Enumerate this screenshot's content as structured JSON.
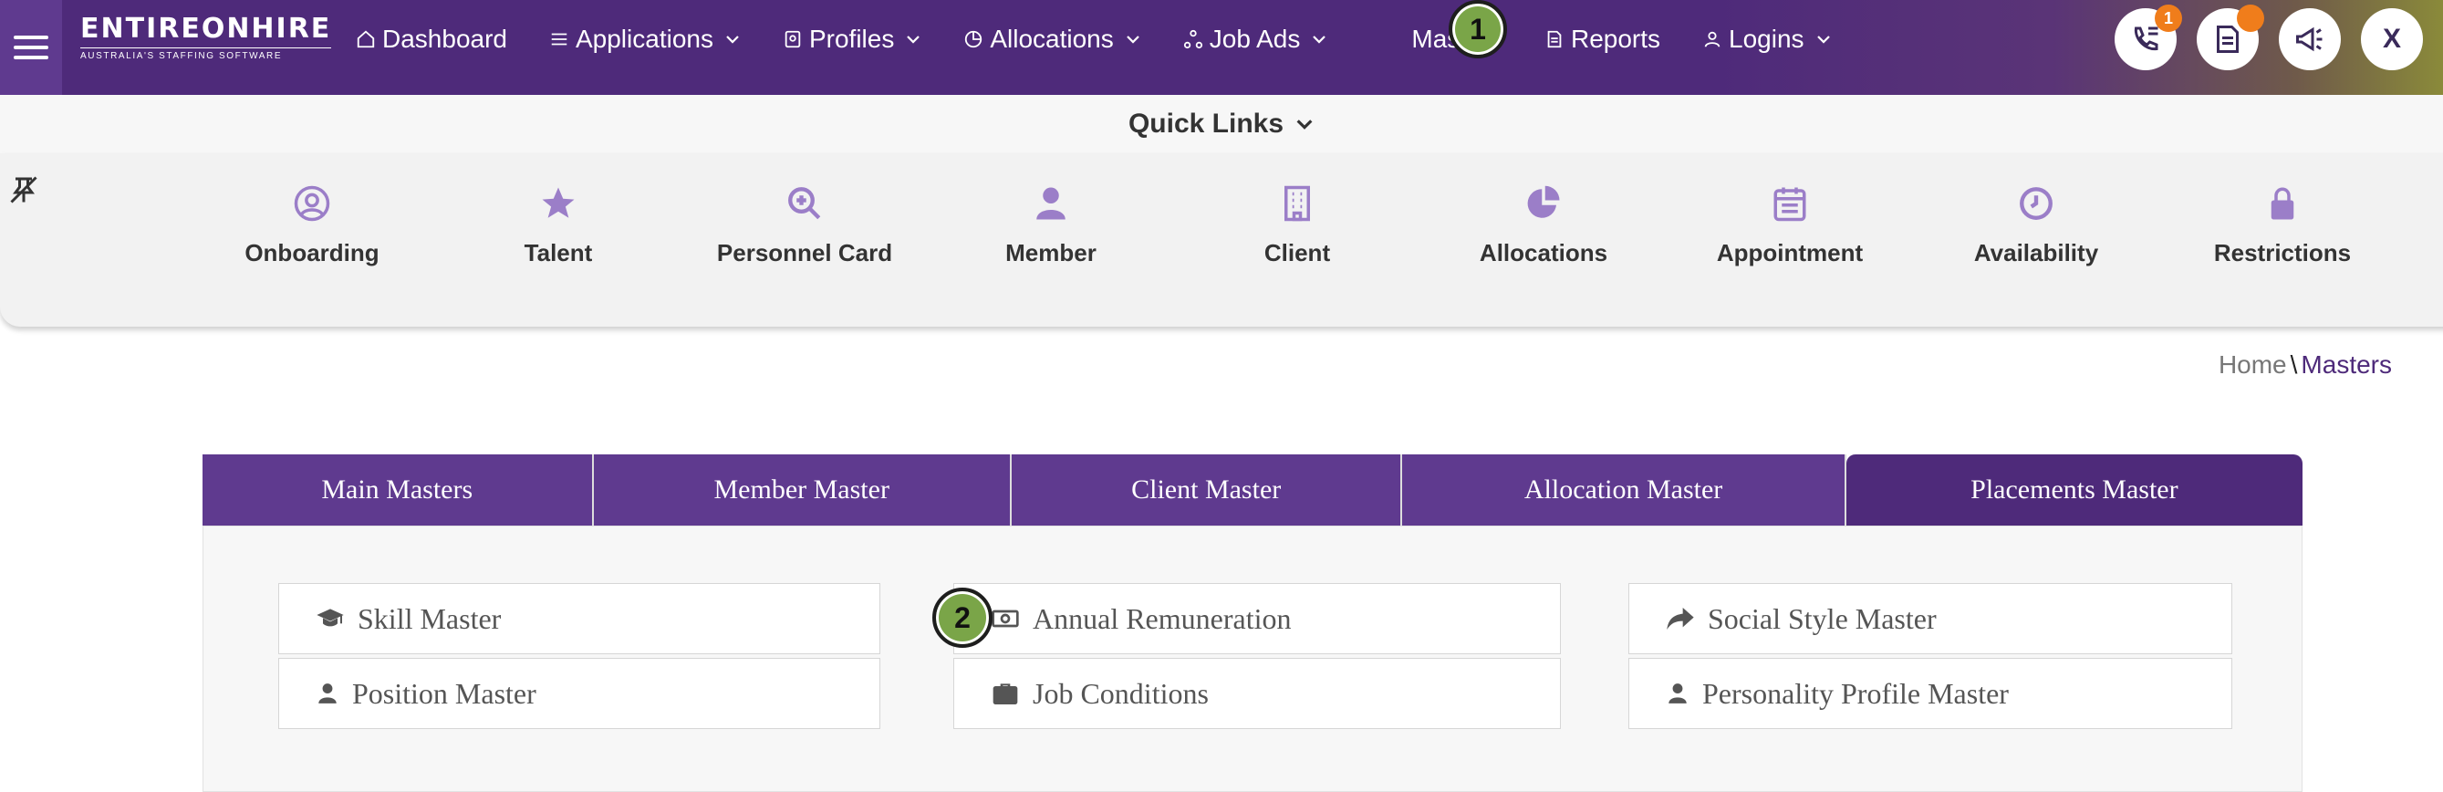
{
  "app": {
    "logo_name": "ENTIREONHIRE",
    "logo_tagline": "AUSTRALIA'S STAFFING SOFTWARE"
  },
  "nav": {
    "dashboard": "Dashboard",
    "applications": "Applications",
    "profiles": "Profiles",
    "allocations": "Allocations",
    "job_ads": "Job Ads",
    "masters": "Masters",
    "reports": "Reports",
    "logins": "Logins"
  },
  "top_icons": {
    "calls_badge": "1",
    "user_initial": "X"
  },
  "step_markers": [
    "1",
    "2"
  ],
  "quick_links": {
    "title": "Quick Links",
    "items": [
      {
        "label": "Onboarding",
        "icon": "user-circle-icon"
      },
      {
        "label": "Talent",
        "icon": "star-icon"
      },
      {
        "label": "Personnel Card",
        "icon": "search-plus-icon"
      },
      {
        "label": "Member",
        "icon": "user-icon"
      },
      {
        "label": "Client",
        "icon": "building-icon"
      },
      {
        "label": "Allocations",
        "icon": "pie-chart-icon"
      },
      {
        "label": "Appointment",
        "icon": "calendar-icon"
      },
      {
        "label": "Availability",
        "icon": "clock-icon"
      },
      {
        "label": "Restrictions",
        "icon": "lock-icon"
      }
    ]
  },
  "breadcrumb": {
    "home": "Home",
    "separator": "\\",
    "current": "Masters"
  },
  "tabs": [
    {
      "label": "Main Masters",
      "active": false
    },
    {
      "label": "Member Master",
      "active": false
    },
    {
      "label": "Client Master",
      "active": false
    },
    {
      "label": "Allocation Master",
      "active": false
    },
    {
      "label": "Placements Master",
      "active": true
    }
  ],
  "masters": {
    "skill": "Skill Master",
    "position": "Position Master",
    "annual_remuneration": "Annual Remuneration",
    "job_conditions": "Job Conditions",
    "social_style": "Social Style Master",
    "personality_profile": "Personality Profile Master"
  },
  "colors": {
    "brand_purple": "#4e2a7a",
    "tab_purple": "#5f3a8f",
    "icon_purple": "#9b7ec8",
    "badge_orange": "#f07d1b",
    "step_green": "#7aa548"
  }
}
